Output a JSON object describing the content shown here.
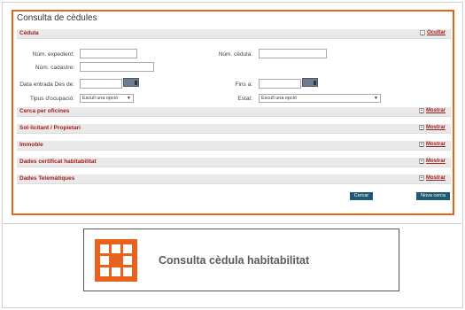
{
  "panel": {
    "title": "Consulta de cèdules"
  },
  "sections": {
    "cedula": {
      "title": "Cèdula",
      "toggle": "Ocultar",
      "toggle_icon": "-"
    },
    "cerca_oficines": {
      "title": "Cerca per oficines",
      "toggle": "Mostrar",
      "toggle_icon": "+"
    },
    "sollicitant": {
      "title": "Sol·licitant / Propietari",
      "toggle": "Mostrar",
      "toggle_icon": "+"
    },
    "immoble": {
      "title": "Immoble",
      "toggle": "Mostrar",
      "toggle_icon": "+"
    },
    "certificat": {
      "title": "Dades certificat habitabilitat",
      "toggle": "Mostrar",
      "toggle_icon": "+"
    },
    "telematiques": {
      "title": "Dades Telemàtiques",
      "toggle": "Mostrar",
      "toggle_icon": "+"
    }
  },
  "form": {
    "num_expedient": {
      "label": "Núm. expedient:",
      "value": ""
    },
    "num_cedula": {
      "label": "Núm. cèdula:",
      "value": ""
    },
    "num_cadastre": {
      "label": "Núm. cadastre:",
      "value": ""
    },
    "data_entrada": {
      "label": "Data entrada Des de:",
      "value": ""
    },
    "fins_a": {
      "label": "Fins a:",
      "value": ""
    },
    "tipus_ocupacio": {
      "label": "Tipus d'ocupació:",
      "selected": "Escull una opció"
    },
    "estat": {
      "label": "Estat:",
      "selected": "Escull una opció"
    }
  },
  "buttons": {
    "cercar": "Cercar",
    "nova_cerca": "Nova cerca"
  },
  "banner": {
    "title": "Consulta cèdula habitabilitat"
  },
  "colors": {
    "accent": "#e8621d",
    "section_title": "#a31d1d",
    "button": "#1f5a73"
  },
  "icons": {
    "calendar": "calendar-icon",
    "dropdown": "chevron-down-icon",
    "logo": "grid-logo-icon"
  }
}
